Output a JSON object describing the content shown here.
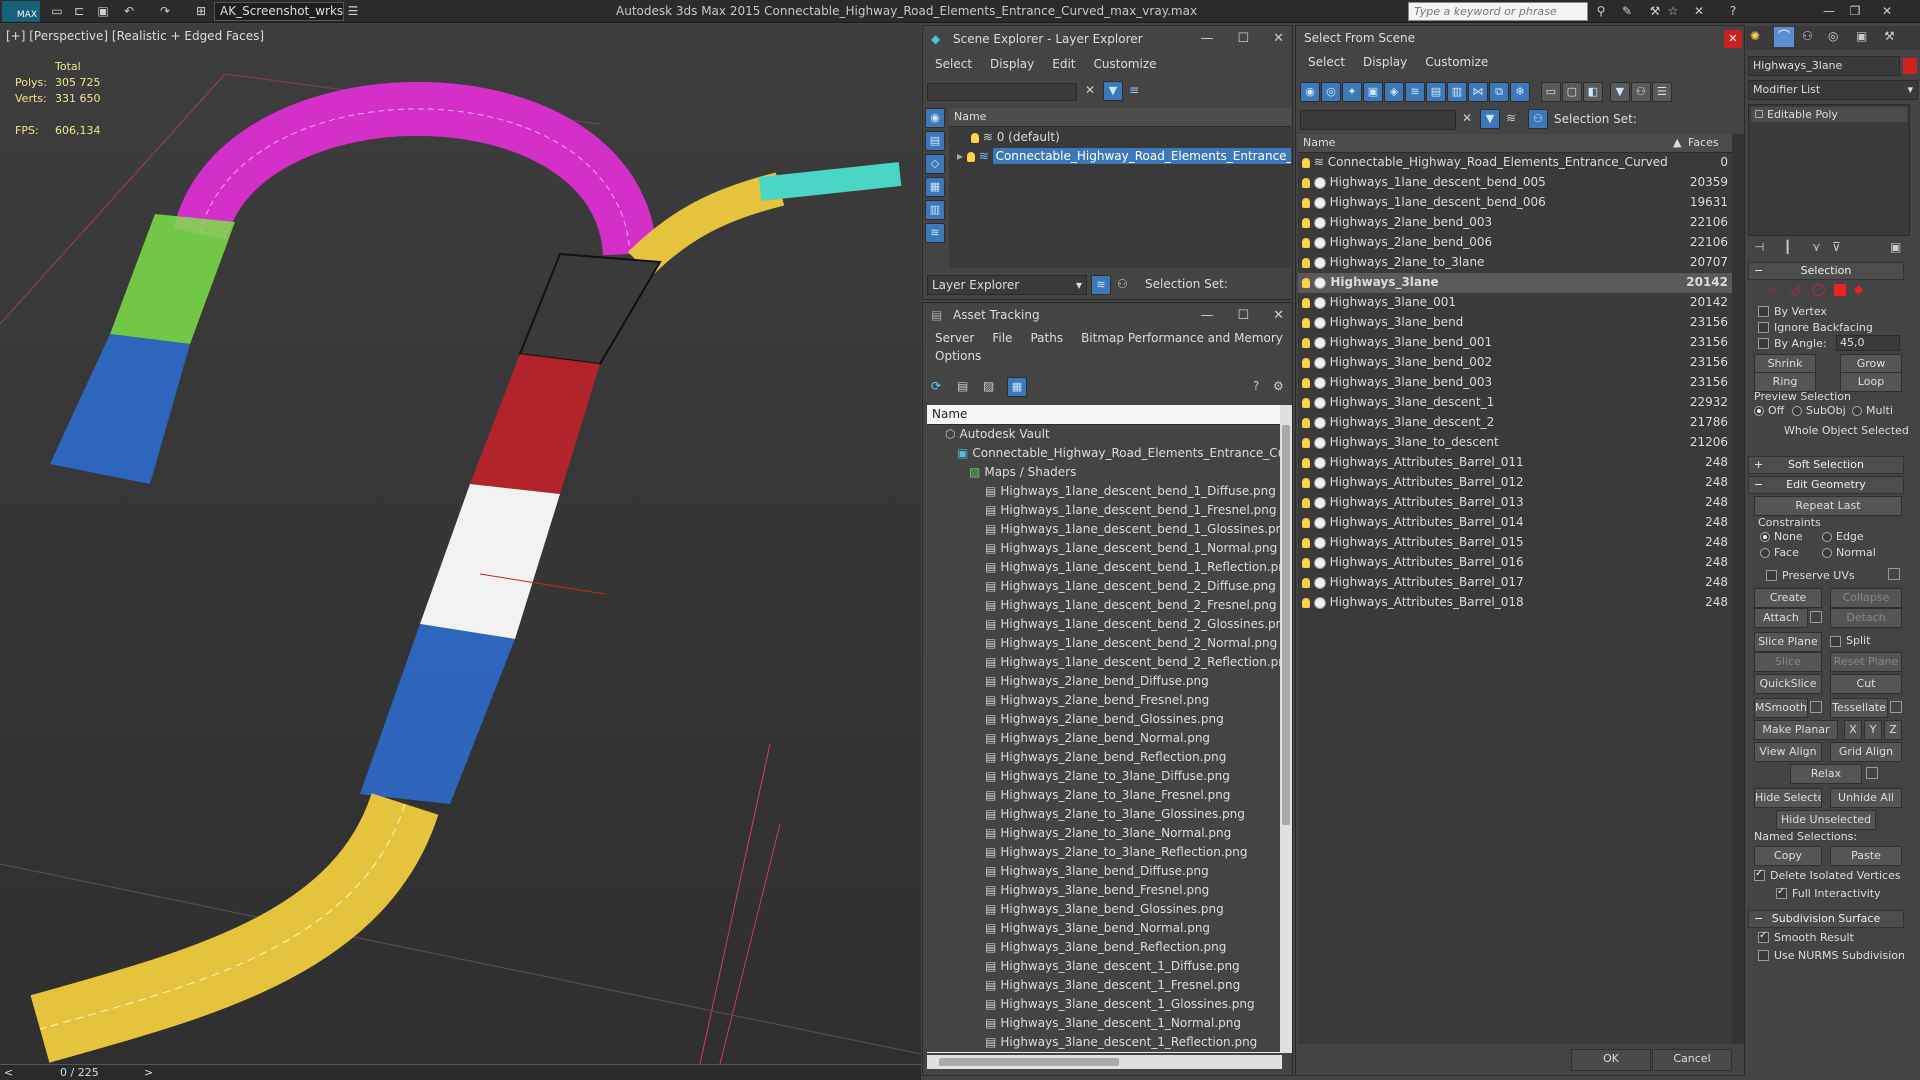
{
  "titlebar": {
    "logo": "MAX",
    "workspace": "AK_Screenshot_wrksp",
    "title": "Autodesk 3ds Max  2015    Connectable_Highway_Road_Elements_Entrance_Curved_max_vray.max",
    "search_placeholder": "Type a keyword or phrase"
  },
  "viewport": {
    "label": "[+] [Perspective] [Realistic + Edged Faces]",
    "stats": {
      "total_label": "Total",
      "polys_label": "Polys:",
      "polys": "305 725",
      "verts_label": "Verts:",
      "verts": "331 650",
      "fps_label": "FPS:",
      "fps": "606,134"
    },
    "timeline": "0 / 225"
  },
  "scene_explorer": {
    "title": "Scene Explorer - Layer Explorer",
    "menu": [
      "Select",
      "Display",
      "Edit",
      "Customize"
    ],
    "col_name": "Name",
    "layers": [
      "0 (default)",
      "Connectable_Highway_Road_Elements_Entrance_Curved"
    ],
    "footer_mode": "Layer Explorer",
    "selection_set": "Selection Set:"
  },
  "asset_tracking": {
    "title": "Asset Tracking",
    "menu": [
      "Server",
      "File",
      "Paths",
      "Bitmap Performance and Memory"
    ],
    "menu2": "Options",
    "col_name": "Name",
    "vault": "Autodesk Vault",
    "file": "Connectable_Highway_Road_Elements_Entrance_Curve",
    "maps": "Maps / Shaders",
    "files": [
      "Highways_1lane_descent_bend_1_Diffuse.png",
      "Highways_1lane_descent_bend_1_Fresnel.png",
      "Highways_1lane_descent_bend_1_Glossines.png",
      "Highways_1lane_descent_bend_1_Normal.png",
      "Highways_1lane_descent_bend_1_Reflection.png",
      "Highways_1lane_descent_bend_2_Diffuse.png",
      "Highways_1lane_descent_bend_2_Fresnel.png",
      "Highways_1lane_descent_bend_2_Glossines.png",
      "Highways_1lane_descent_bend_2_Normal.png",
      "Highways_1lane_descent_bend_2_Reflection.png",
      "Highways_2lane_bend_Diffuse.png",
      "Highways_2lane_bend_Fresnel.png",
      "Highways_2lane_bend_Glossines.png",
      "Highways_2lane_bend_Normal.png",
      "Highways_2lane_bend_Reflection.png",
      "Highways_2lane_to_3lane_Diffuse.png",
      "Highways_2lane_to_3lane_Fresnel.png",
      "Highways_2lane_to_3lane_Glossines.png",
      "Highways_2lane_to_3lane_Normal.png",
      "Highways_2lane_to_3lane_Reflection.png",
      "Highways_3lane_bend_Diffuse.png",
      "Highways_3lane_bend_Fresnel.png",
      "Highways_3lane_bend_Glossines.png",
      "Highways_3lane_bend_Normal.png",
      "Highways_3lane_bend_Reflection.png",
      "Highways_3lane_descent_1_Diffuse.png",
      "Highways_3lane_descent_1_Fresnel.png",
      "Highways_3lane_descent_1_Glossines.png",
      "Highways_3lane_descent_1_Normal.png",
      "Highways_3lane_descent_1_Reflection.png"
    ]
  },
  "select_from_scene": {
    "title": "Select From Scene",
    "menu": [
      "Select",
      "Display",
      "Customize"
    ],
    "selection_set": "Selection Set:",
    "col_name": "Name",
    "col_faces": "Faces",
    "ok": "OK",
    "cancel": "Cancel",
    "rows": [
      {
        "name": "Connectable_Highway_Road_Elements_Entrance_Curved",
        "faces": "0"
      },
      {
        "name": "Highways_1lane_descent_bend_005",
        "faces": "20359"
      },
      {
        "name": "Highways_1lane_descent_bend_006",
        "faces": "19631"
      },
      {
        "name": "Highways_2lane_bend_003",
        "faces": "22106"
      },
      {
        "name": "Highways_2lane_bend_006",
        "faces": "22106"
      },
      {
        "name": "Highways_2lane_to_3lane",
        "faces": "20707"
      },
      {
        "name": "Highways_3lane",
        "faces": "20142"
      },
      {
        "name": "Highways_3lane_001",
        "faces": "20142"
      },
      {
        "name": "Highways_3lane_bend",
        "faces": "23156"
      },
      {
        "name": "Highways_3lane_bend_001",
        "faces": "23156"
      },
      {
        "name": "Highways_3lane_bend_002",
        "faces": "23156"
      },
      {
        "name": "Highways_3lane_bend_003",
        "faces": "23156"
      },
      {
        "name": "Highways_3lane_descent_1",
        "faces": "22932"
      },
      {
        "name": "Highways_3lane_descent_2",
        "faces": "21786"
      },
      {
        "name": "Highways_3lane_to_descent",
        "faces": "21206"
      },
      {
        "name": "Highways_Attributes_Barrel_011",
        "faces": "248"
      },
      {
        "name": "Highways_Attributes_Barrel_012",
        "faces": "248"
      },
      {
        "name": "Highways_Attributes_Barrel_013",
        "faces": "248"
      },
      {
        "name": "Highways_Attributes_Barrel_014",
        "faces": "248"
      },
      {
        "name": "Highways_Attributes_Barrel_015",
        "faces": "248"
      },
      {
        "name": "Highways_Attributes_Barrel_016",
        "faces": "248"
      },
      {
        "name": "Highways_Attributes_Barrel_017",
        "faces": "248"
      },
      {
        "name": "Highways_Attributes_Barrel_018",
        "faces": "248"
      }
    ]
  },
  "command_panel": {
    "object_name": "Highways_3lane",
    "modifier_list": "Modifier List",
    "stack_item": "Editable Poly",
    "selection": {
      "title": "Selection",
      "by_vertex": "By Vertex",
      "ignore_backfacing": "Ignore Backfacing",
      "by_angle": "By Angle:",
      "angle": "45,0",
      "shrink": "Shrink",
      "grow": "Grow",
      "ring": "Ring",
      "loop": "Loop",
      "preview": "Preview Selection",
      "off": "Off",
      "subobj": "SubObj",
      "multi": "Multi",
      "whole": "Whole Object Selected"
    },
    "soft_selection": "Soft Selection",
    "edit_geometry": {
      "title": "Edit Geometry",
      "repeat_last": "Repeat Last",
      "constraints": "Constraints",
      "none": "None",
      "edge": "Edge",
      "face": "Face",
      "normal": "Normal",
      "preserve_uvs": "Preserve UVs",
      "create": "Create",
      "collapse": "Collapse",
      "attach": "Attach",
      "detach": "Detach",
      "slice_plane": "Slice Plane",
      "split": "Split",
      "slice": "Slice",
      "reset_plane": "Reset Plane",
      "quickslice": "QuickSlice",
      "cut": "Cut",
      "msmooth": "MSmooth",
      "tessellate": "Tessellate",
      "make_planar": "Make Planar",
      "x": "X",
      "y": "Y",
      "z": "Z",
      "view_align": "View Align",
      "grid_align": "Grid Align",
      "relax": "Relax",
      "hide_selected": "Hide Selected",
      "unhide_all": "Unhide All",
      "hide_unselected": "Hide Unselected",
      "named_selections": "Named Selections:",
      "copy": "Copy",
      "paste": "Paste",
      "delete_isolated": "Delete Isolated Vertices",
      "full_interactivity": "Full Interactivity"
    },
    "subdivision": {
      "title": "Subdivision Surface",
      "smooth_result": "Smooth Result",
      "use_nurms": "Use NURMS Subdivision"
    }
  },
  "colors": {
    "magenta": "#d42fc9",
    "green": "#7ee04a",
    "blue": "#2d6fd6",
    "yellow": "#e6c33d",
    "cyan": "#49d6c4",
    "red": "#c8202a",
    "white": "#f2f2f2",
    "selection": "#3d79b8"
  }
}
